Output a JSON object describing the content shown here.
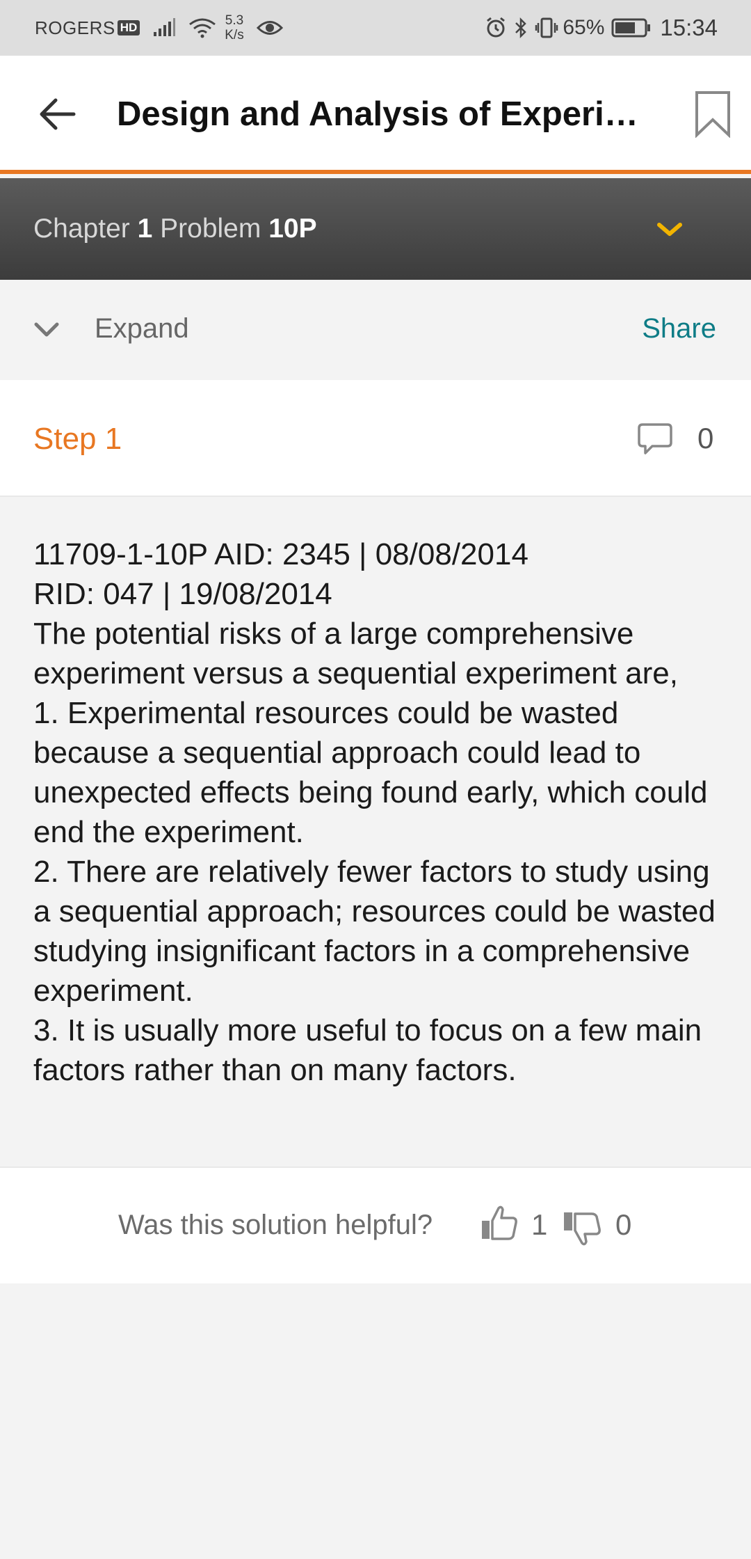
{
  "status_bar": {
    "carrier": "ROGERS",
    "hd": "HD",
    "speed_value": "5.3",
    "speed_unit": "K/s",
    "battery": "65%",
    "time": "15:34"
  },
  "app_bar": {
    "title": "Design and Analysis of Experiments"
  },
  "chapter_bar": {
    "chapter_label": "Chapter",
    "chapter_number": "1",
    "problem_label": "Problem",
    "problem_number": "10P"
  },
  "expand_row": {
    "expand_label": "Expand",
    "share_label": "Share"
  },
  "step": {
    "title": "Step 1",
    "comment_count": "0"
  },
  "solution": {
    "lines": [
      "11709-1-10P AID: 2345 | 08/08/2014",
      "RID: 047 | 19/08/2014",
      "The potential risks of a large comprehensive experiment versus a sequential experiment are,",
      "1. Experimental resources could be wasted because a sequential approach could lead to unexpected effects being found early, which could end the experiment.",
      "2. There are relatively fewer factors to study using a sequential approach; resources could be wasted studying insignificant factors in a comprehensive experiment.",
      "3. It is usually more useful to focus on a few main factors rather than on many factors."
    ]
  },
  "feedback": {
    "question": "Was this solution helpful?",
    "up_count": "1",
    "down_count": "0"
  },
  "colors": {
    "accent_orange": "#e87722",
    "share_teal": "#0e7c86",
    "caret_yellow": "#f2b400"
  }
}
